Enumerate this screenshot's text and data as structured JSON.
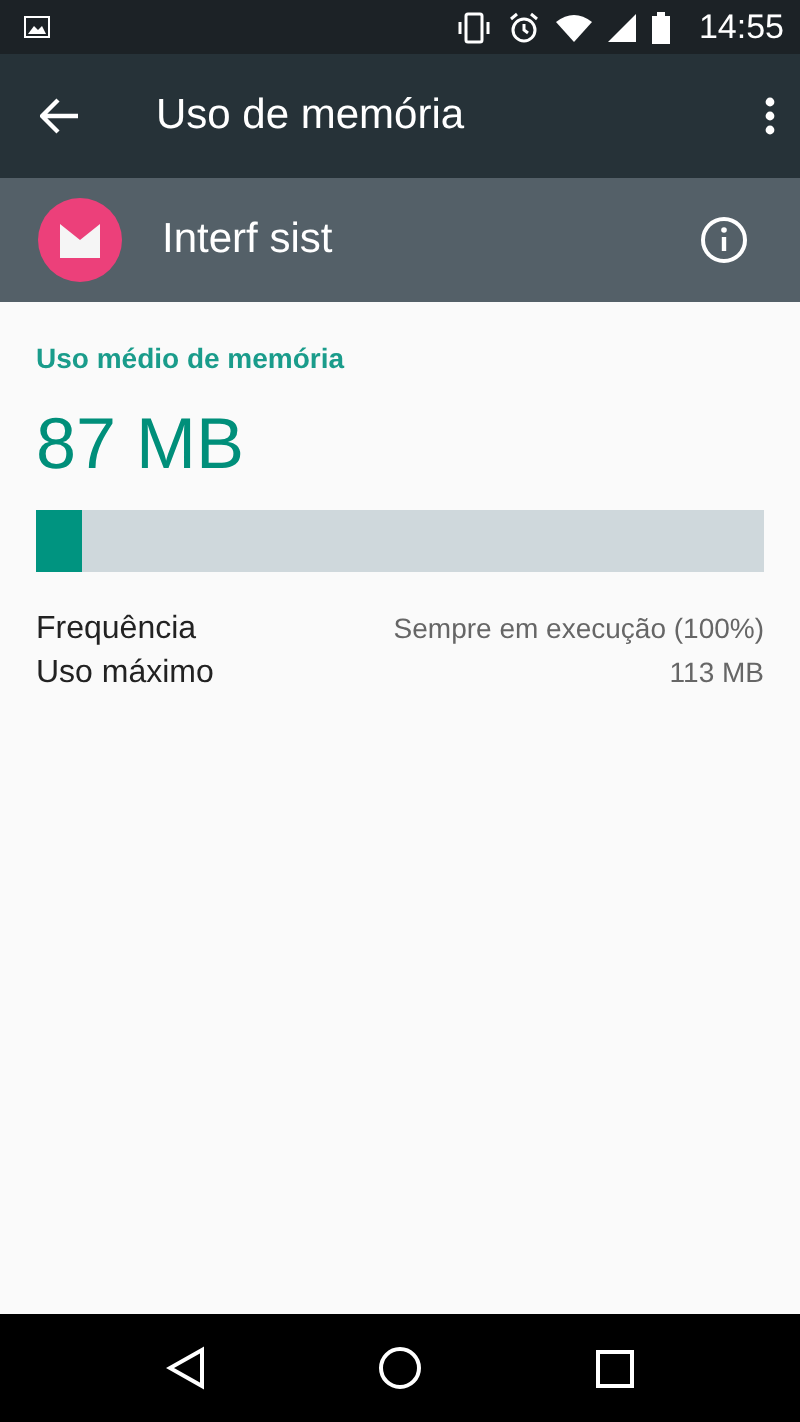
{
  "status_bar": {
    "time": "14:55"
  },
  "toolbar": {
    "title": "Uso de memória"
  },
  "app": {
    "name": "Interf sist"
  },
  "memory": {
    "heading": "Uso médio de memória",
    "value": "87 MB",
    "level": 0.063
  },
  "stats": [
    {
      "label": "Frequência",
      "value": "Sempre em execução (100%)"
    },
    {
      "label": "Uso máximo",
      "value": "113 MB"
    }
  ]
}
